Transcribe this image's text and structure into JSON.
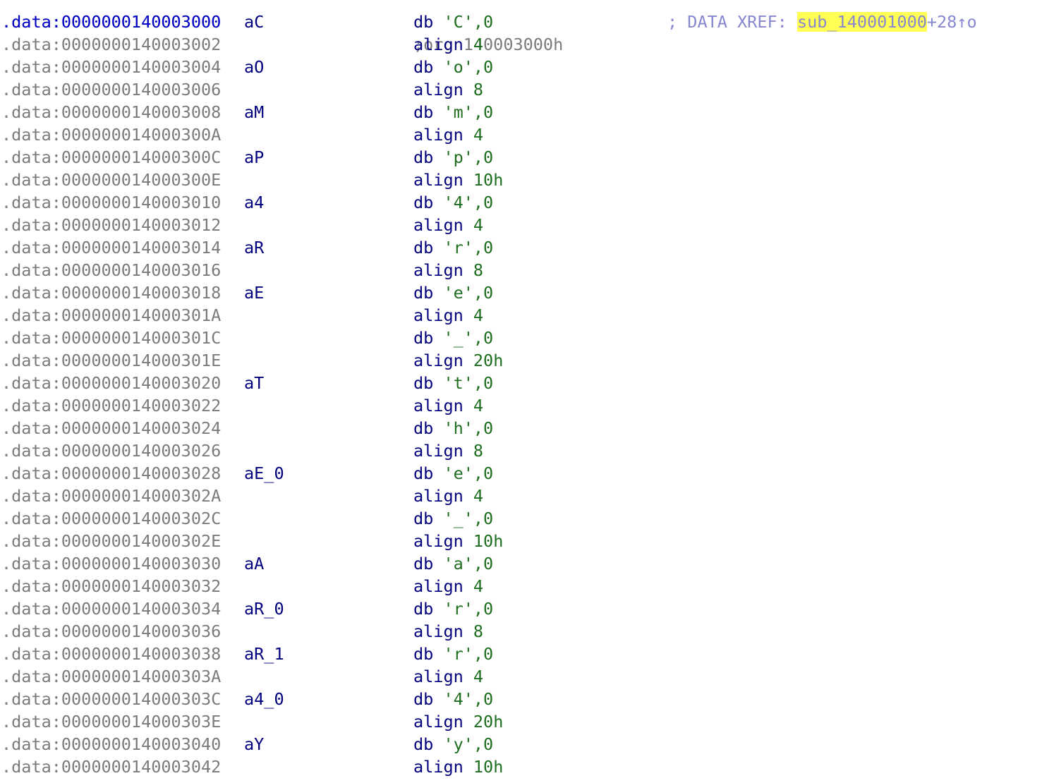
{
  "colors": {
    "background": "#ffffff",
    "address": "#7b7b7b",
    "current_address": "#0000c8",
    "mnemonic": "#00007f",
    "operand": "#1f6e1f",
    "comment": "#8787d0",
    "highlight": "#ffff54"
  },
  "top_partial_row": {
    "address": ".data:0000000140003000",
    "directive": ";org 140003000h"
  },
  "rows": [
    {
      "address": ".data:0000000140003000",
      "label": "aC",
      "mnemonic": "db",
      "operand": "'C'",
      "tail": ",0",
      "current": true,
      "comment_prefix": "; DATA XREF: ",
      "xref": "sub_140001000",
      "xref_suffix": "+28↑o"
    },
    {
      "address": ".data:0000000140003002",
      "label": "",
      "mnemonic": "align",
      "operand": "4"
    },
    {
      "address": ".data:0000000140003004",
      "label": "aO",
      "mnemonic": "db",
      "operand": "'o'",
      "tail": ",0"
    },
    {
      "address": ".data:0000000140003006",
      "label": "",
      "mnemonic": "align",
      "operand": "8"
    },
    {
      "address": ".data:0000000140003008",
      "label": "aM",
      "mnemonic": "db",
      "operand": "'m'",
      "tail": ",0"
    },
    {
      "address": ".data:000000014000300A",
      "label": "",
      "mnemonic": "align",
      "operand": "4"
    },
    {
      "address": ".data:000000014000300C",
      "label": "aP",
      "mnemonic": "db",
      "operand": "'p'",
      "tail": ",0"
    },
    {
      "address": ".data:000000014000300E",
      "label": "",
      "mnemonic": "align",
      "operand": "10h"
    },
    {
      "address": ".data:0000000140003010",
      "label": "a4",
      "mnemonic": "db",
      "operand": "'4'",
      "tail": ",0"
    },
    {
      "address": ".data:0000000140003012",
      "label": "",
      "mnemonic": "align",
      "operand": "4"
    },
    {
      "address": ".data:0000000140003014",
      "label": "aR",
      "mnemonic": "db",
      "operand": "'r'",
      "tail": ",0"
    },
    {
      "address": ".data:0000000140003016",
      "label": "",
      "mnemonic": "align",
      "operand": "8"
    },
    {
      "address": ".data:0000000140003018",
      "label": "aE",
      "mnemonic": "db",
      "operand": "'e'",
      "tail": ",0"
    },
    {
      "address": ".data:000000014000301A",
      "label": "",
      "mnemonic": "align",
      "operand": "4"
    },
    {
      "address": ".data:000000014000301C",
      "label": "",
      "mnemonic": "db",
      "operand": "'_'",
      "tail": ",0"
    },
    {
      "address": ".data:000000014000301E",
      "label": "",
      "mnemonic": "align",
      "operand": "20h"
    },
    {
      "address": ".data:0000000140003020",
      "label": "aT",
      "mnemonic": "db",
      "operand": "'t'",
      "tail": ",0"
    },
    {
      "address": ".data:0000000140003022",
      "label": "",
      "mnemonic": "align",
      "operand": "4"
    },
    {
      "address": ".data:0000000140003024",
      "label": "",
      "mnemonic": "db",
      "operand": "'h'",
      "tail": ",0"
    },
    {
      "address": ".data:0000000140003026",
      "label": "",
      "mnemonic": "align",
      "operand": "8"
    },
    {
      "address": ".data:0000000140003028",
      "label": "aE_0",
      "mnemonic": "db",
      "operand": "'e'",
      "tail": ",0"
    },
    {
      "address": ".data:000000014000302A",
      "label": "",
      "mnemonic": "align",
      "operand": "4"
    },
    {
      "address": ".data:000000014000302C",
      "label": "",
      "mnemonic": "db",
      "operand": "'_'",
      "tail": ",0"
    },
    {
      "address": ".data:000000014000302E",
      "label": "",
      "mnemonic": "align",
      "operand": "10h"
    },
    {
      "address": ".data:0000000140003030",
      "label": "aA",
      "mnemonic": "db",
      "operand": "'a'",
      "tail": ",0"
    },
    {
      "address": ".data:0000000140003032",
      "label": "",
      "mnemonic": "align",
      "operand": "4"
    },
    {
      "address": ".data:0000000140003034",
      "label": "aR_0",
      "mnemonic": "db",
      "operand": "'r'",
      "tail": ",0"
    },
    {
      "address": ".data:0000000140003036",
      "label": "",
      "mnemonic": "align",
      "operand": "8"
    },
    {
      "address": ".data:0000000140003038",
      "label": "aR_1",
      "mnemonic": "db",
      "operand": "'r'",
      "tail": ",0"
    },
    {
      "address": ".data:000000014000303A",
      "label": "",
      "mnemonic": "align",
      "operand": "4"
    },
    {
      "address": ".data:000000014000303C",
      "label": "a4_0",
      "mnemonic": "db",
      "operand": "'4'",
      "tail": ",0"
    },
    {
      "address": ".data:000000014000303E",
      "label": "",
      "mnemonic": "align",
      "operand": "20h"
    },
    {
      "address": ".data:0000000140003040",
      "label": "aY",
      "mnemonic": "db",
      "operand": "'y'",
      "tail": ",0"
    },
    {
      "address": ".data:0000000140003042",
      "label": "",
      "mnemonic": "align",
      "operand": "10h"
    }
  ]
}
